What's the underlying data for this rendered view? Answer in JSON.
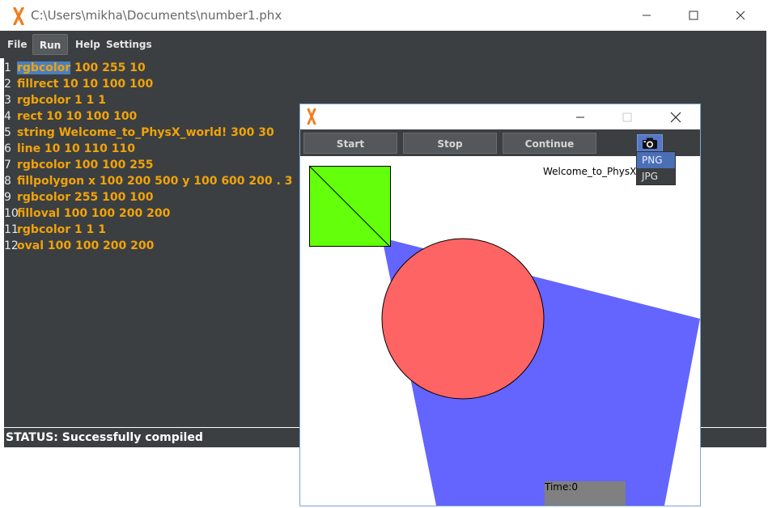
{
  "main_window": {
    "title": "C:\\Users\\mikha\\Documents\\number1.phx",
    "menu": {
      "file": "File",
      "run": "Run",
      "help": "Help",
      "settings": "Settings"
    },
    "code_lines": [
      {
        "num": "1",
        "text": "rgbcolor 100 255 10",
        "highlight": "rgbcolor",
        "rest": " 100 255 10"
      },
      {
        "num": "2",
        "text": "fillrect 10 10 100 100"
      },
      {
        "num": "3",
        "text": "rgbcolor 1 1 1"
      },
      {
        "num": "4",
        "text": "rect 10 10 100 100"
      },
      {
        "num": "5",
        "text": "string Welcome_to_PhysX_world! 300 30"
      },
      {
        "num": "6",
        "text": "line 10 10 110 110"
      },
      {
        "num": "7",
        "text": "rgbcolor 100 100 255"
      },
      {
        "num": "8",
        "text": "fillpolygon x 100 200 500 y 100 600 200 . 3"
      },
      {
        "num": "9",
        "text": "rgbcolor 255 100 100"
      },
      {
        "num": "10",
        "text": "filloval 100 100 200 200"
      },
      {
        "num": "11",
        "text": "rgbcolor 1 1 1"
      },
      {
        "num": "12",
        "text": "oval 100 100 200 200"
      }
    ],
    "status": "STATUS: Successfully compiled"
  },
  "preview_window": {
    "toolbar": {
      "start": "Start",
      "stop": "Stop",
      "continue": "Continue"
    },
    "export_menu": [
      "PNG",
      "JPG"
    ],
    "canvas_text": "Welcome_to_PhysX_",
    "time_label": "Time:0"
  },
  "icons": {
    "app": "physx-logo-icon",
    "camera": "camera-icon",
    "minimize": "minimize-icon",
    "maximize": "maximize-icon",
    "close": "close-icon"
  },
  "colors": {
    "editor_bg": "#3c3f41",
    "code_text": "#f0a30a",
    "highlight": "#4a7fc0",
    "green": "#64ff0a",
    "blue": "#6464ff",
    "red": "#ff6464",
    "logo_orange": "#f07a1a"
  }
}
